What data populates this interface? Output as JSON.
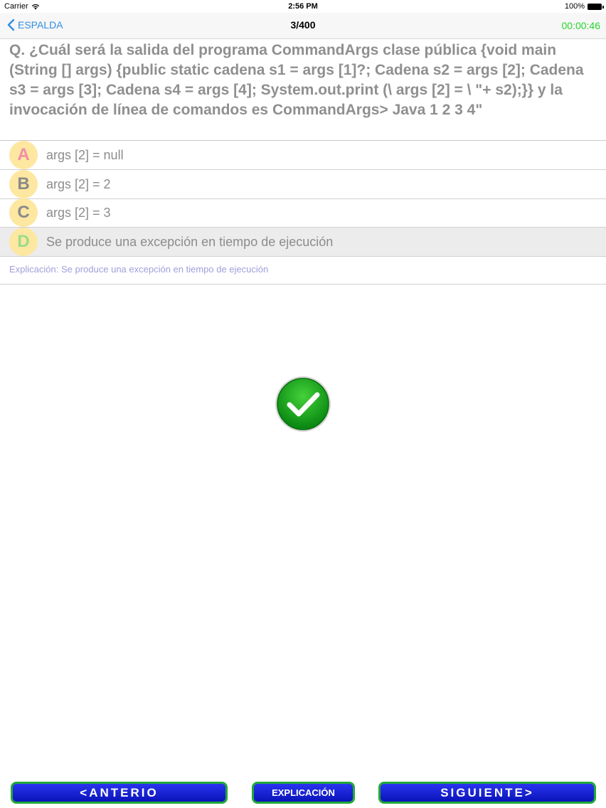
{
  "status_bar": {
    "carrier": "Carrier",
    "time": "2:56 PM",
    "battery": "100%"
  },
  "nav": {
    "back_label": "ESPALDA",
    "title": "3/400",
    "timer": "00:00:46"
  },
  "question": "Q. ¿Cuál será la salida del programa CommandArgs clase pública {void main (String [] args) {public static cadena s1 = args [1]?; Cadena s2 = args [2]; Cadena s3 = args [3]; Cadena s4 = args [4]; System.out.print (\\ args [2] = \\ \"+ s2);}} y la invocación de línea de comandos es CommandArgs> Java 1 2 3 4\"",
  "options": [
    {
      "letter": "A",
      "text": "args [2] = null",
      "color": "#f48ca8"
    },
    {
      "letter": "B",
      "text": "args [2] = 2",
      "color": "#8a8a8a"
    },
    {
      "letter": "C",
      "text": "args [2] = 3",
      "color": "#8a8a8a"
    },
    {
      "letter": "D",
      "text": "Se produce una excepción en tiempo de ejecución",
      "color": "#9bdc8a"
    }
  ],
  "explanation": "Explicación: Se produce una excepción en tiempo de ejecución",
  "result_icon": "checkmark-correct-icon",
  "buttons": {
    "prev": "<ANTERIO",
    "explain": "EXPLICACIÓN",
    "next": "SIGUIENTE>"
  }
}
